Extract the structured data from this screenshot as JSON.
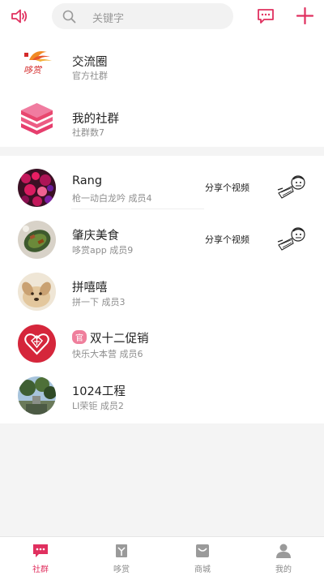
{
  "search": {
    "placeholder": "关键字"
  },
  "official": [
    {
      "name": "交流圈",
      "sub": "官方社群",
      "icon": "gold-logo-icon"
    },
    {
      "name": "我的社群",
      "sub": "社群数7",
      "icon": "stack-icon"
    }
  ],
  "groups": [
    {
      "name": "Rang",
      "sub": "枪一动白龙吟 成员4",
      "share": "分享个视频",
      "avatar": "flowers-avatar"
    },
    {
      "name": "肇庆美食",
      "sub": "哆赏app 成员9",
      "share": "分享个视频",
      "avatar": "food-avatar"
    },
    {
      "name": "拼嘻嘻",
      "sub": "拼一下 成员3",
      "avatar": "dog-avatar"
    },
    {
      "badge": "官",
      "name": "双十二促销",
      "sub": "快乐大本营 成员6",
      "avatar": "heart-logo-avatar"
    },
    {
      "name": "1024工程",
      "sub": "LI荣钜 成员2",
      "avatar": "trees-avatar"
    }
  ],
  "tabs": [
    {
      "label": "社群",
      "active": true
    },
    {
      "label": "哆赏"
    },
    {
      "label": "商城"
    },
    {
      "label": "我的"
    }
  ],
  "colors": {
    "accent": "#e0305f",
    "inactive": "#9a9a9a"
  }
}
